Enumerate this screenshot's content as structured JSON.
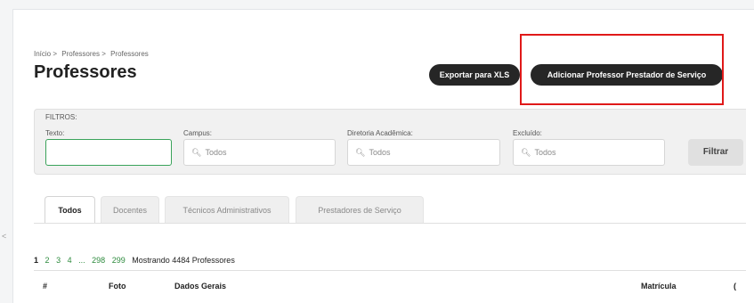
{
  "breadcrumb": [
    "Início",
    "Professores",
    "Professores"
  ],
  "breadcrumb_sep": ">",
  "page_title": "Professores",
  "buttons": {
    "export": "Exportar para XLS",
    "add": "Adicionar Professor Prestador de Serviço",
    "filter": "Filtrar"
  },
  "highlight_color": "#e01919",
  "filters": {
    "title": "FILTROS:",
    "texto_label": "Texto:",
    "texto_value": "",
    "campus_label": "Campus:",
    "campus_value": "Todos",
    "diretoria_label": "Diretoria Acadêmica:",
    "diretoria_value": "Todos",
    "excluido_label": "Excluído:",
    "excluido_value": "Todos",
    "search_icon": "magnifier-icon"
  },
  "tabs": [
    "Todos",
    "Docentes",
    "Técnicos Administrativos",
    "Prestadores de Serviço"
  ],
  "active_tab": "Todos",
  "pagination": {
    "pages": [
      "1",
      "2",
      "3",
      "4",
      "...",
      "298",
      "299"
    ],
    "current": "1",
    "info": "Mostrando 4484 Professores"
  },
  "table": {
    "headers": [
      "#",
      "Foto",
      "Dados Gerais",
      "Matrícula",
      "("
    ]
  },
  "side_mark": "<"
}
